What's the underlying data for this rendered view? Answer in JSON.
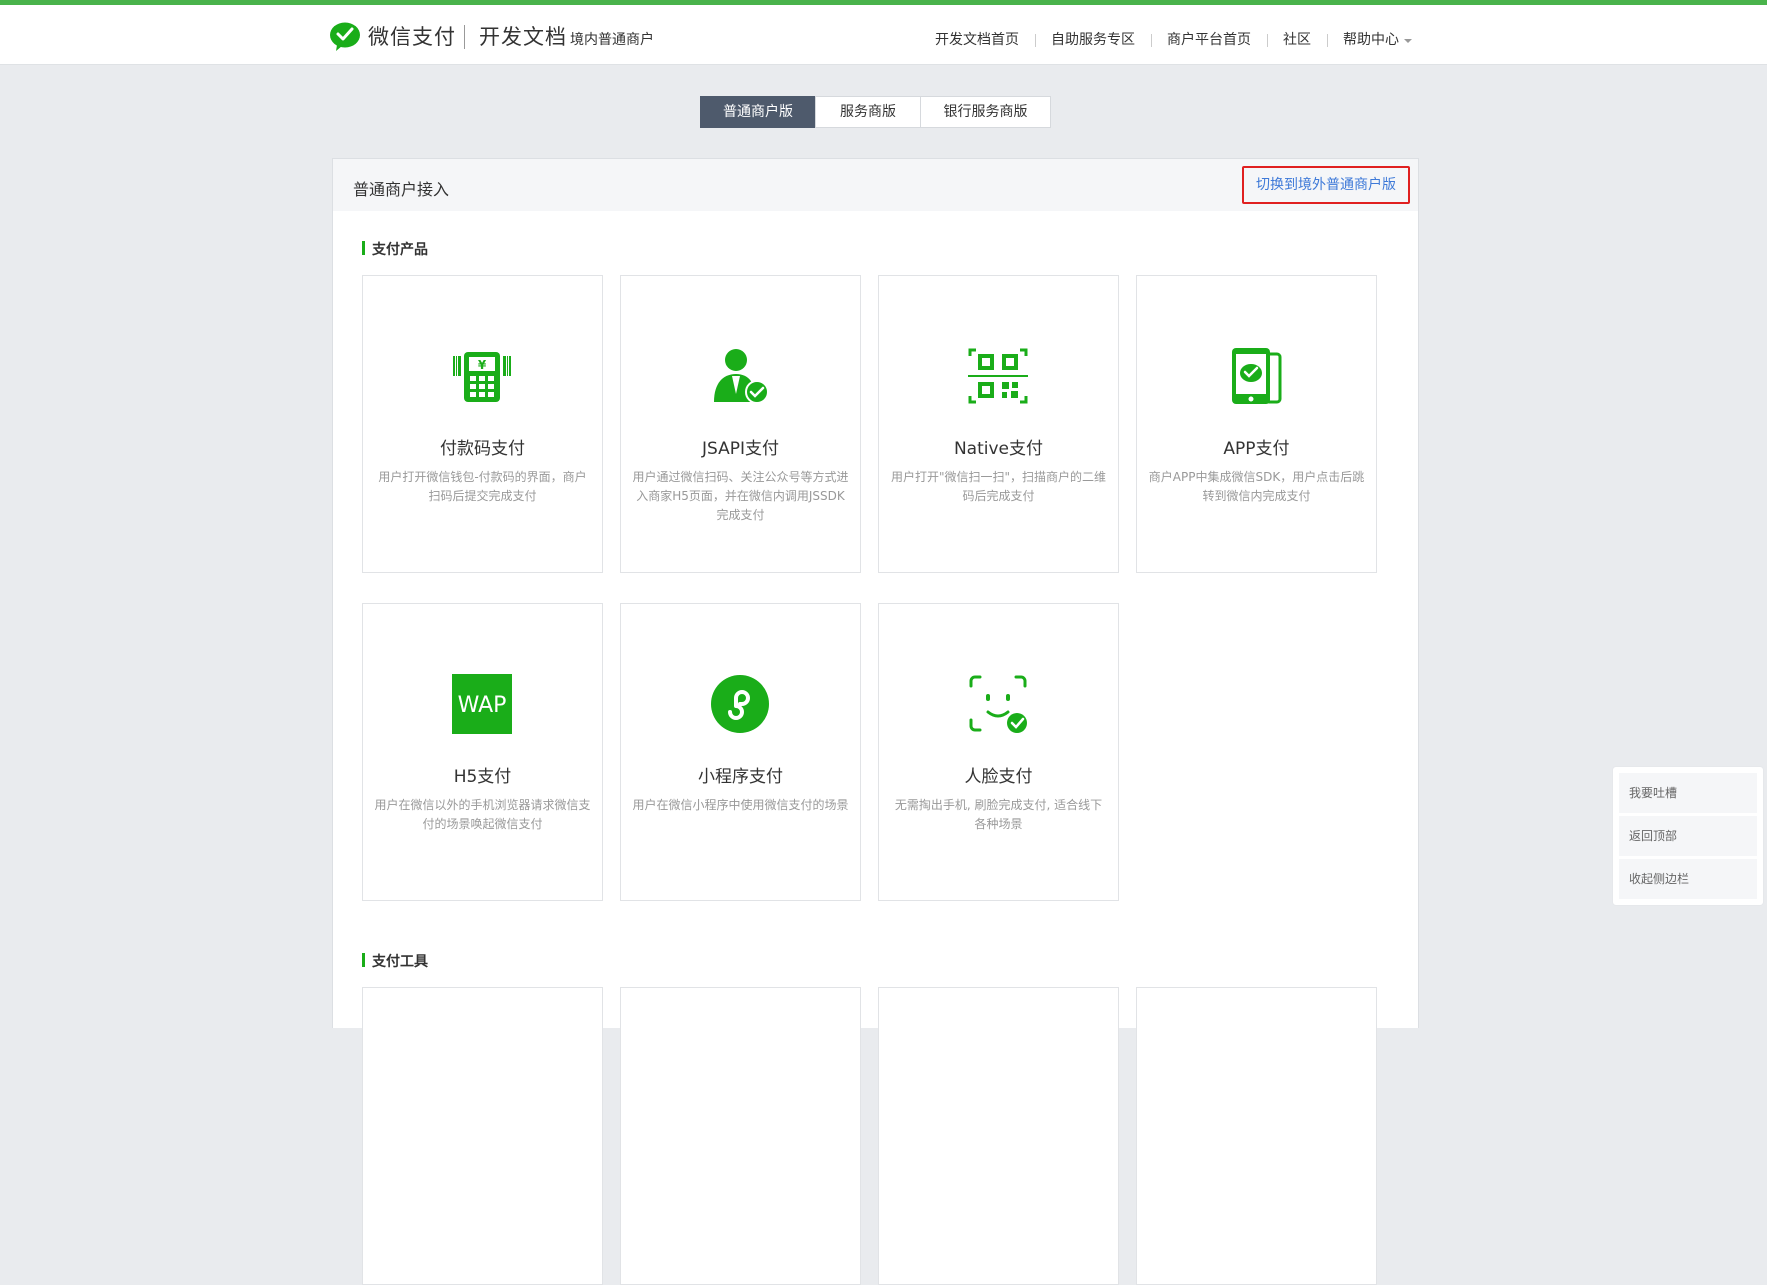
{
  "header": {
    "brand": "微信支付",
    "doc_title": "开发文档",
    "doc_subtitle": "境内普通商户",
    "nav": [
      "开发文档首页",
      "自助服务专区",
      "商户平台首页",
      "社区",
      "帮助中心"
    ]
  },
  "tabs": [
    "普通商户版",
    "服务商版",
    "银行服务商版"
  ],
  "panel": {
    "title": "普通商户接入",
    "switch_label": "切换到境外普通商户版"
  },
  "sections": {
    "products_title": "支付产品",
    "tools_title": "支付工具"
  },
  "products": [
    {
      "name": "付款码支付",
      "desc": "用户打开微信钱包-付款码的界面，商户扫码后提交完成支付",
      "icon": "pos-terminal-icon"
    },
    {
      "name": "JSAPI支付",
      "desc": "用户通过微信扫码、关注公众号等方式进入商家H5页面，并在微信内调用JSSDK完成支付",
      "icon": "user-check-icon"
    },
    {
      "name": "Native支付",
      "desc": "用户打开\"微信扫一扫\"，扫描商户的二维码后完成支付",
      "icon": "qr-scan-icon"
    },
    {
      "name": "APP支付",
      "desc": "商户APP中集成微信SDK，用户点击后跳转到微信内完成支付",
      "icon": "phone-wechat-icon"
    },
    {
      "name": "H5支付",
      "desc": "用户在微信以外的手机浏览器请求微信支付的场景唤起微信支付",
      "icon": "wap-icon",
      "icon_text": "WAP"
    },
    {
      "name": "小程序支付",
      "desc": "用户在微信小程序中使用微信支付的场景",
      "icon": "mini-program-icon"
    },
    {
      "name": "人脸支付",
      "desc": "无需掏出手机, 刷脸完成支付, 适合线下各种场景",
      "icon": "face-check-icon"
    }
  ],
  "float_menu": [
    "我要吐槽",
    "返回顶部",
    "收起侧边栏"
  ],
  "colors": {
    "accent_green": "#1aad19",
    "tab_active": "#4e5a6c",
    "link_blue": "#3f7ad8",
    "highlight_red": "#e02020"
  }
}
